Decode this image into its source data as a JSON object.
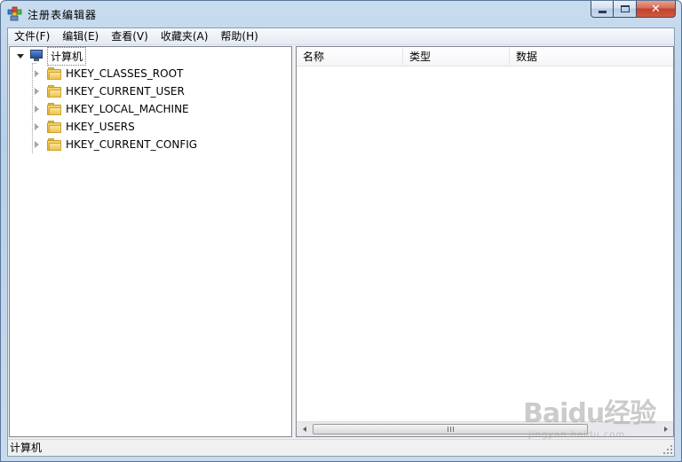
{
  "window": {
    "title": "注册表编辑器",
    "icon": "regedit-icon",
    "controls": {
      "minimize": "minimize",
      "maximize": "maximize",
      "close": "close"
    }
  },
  "menu": [
    {
      "label": "文件(F)"
    },
    {
      "label": "编辑(E)"
    },
    {
      "label": "查看(V)"
    },
    {
      "label": "收藏夹(A)"
    },
    {
      "label": "帮助(H)"
    }
  ],
  "tree": {
    "root": {
      "label": "计算机",
      "icon": "computer-icon",
      "expanded": true
    },
    "children": [
      {
        "label": "HKEY_CLASSES_ROOT",
        "icon": "folder-icon"
      },
      {
        "label": "HKEY_CURRENT_USER",
        "icon": "folder-icon"
      },
      {
        "label": "HKEY_LOCAL_MACHINE",
        "icon": "folder-icon"
      },
      {
        "label": "HKEY_USERS",
        "icon": "folder-icon"
      },
      {
        "label": "HKEY_CURRENT_CONFIG",
        "icon": "folder-icon"
      }
    ]
  },
  "list": {
    "columns": [
      "名称",
      "类型",
      "数据"
    ],
    "rows": []
  },
  "status": {
    "path": "计算机"
  },
  "watermark": {
    "main": "Baidu经验",
    "sub": "jingyan.baidu.com"
  },
  "colors": {
    "close_button": "#c1432b",
    "title_bar": "#c9dcef",
    "pane_border": "#828790"
  }
}
